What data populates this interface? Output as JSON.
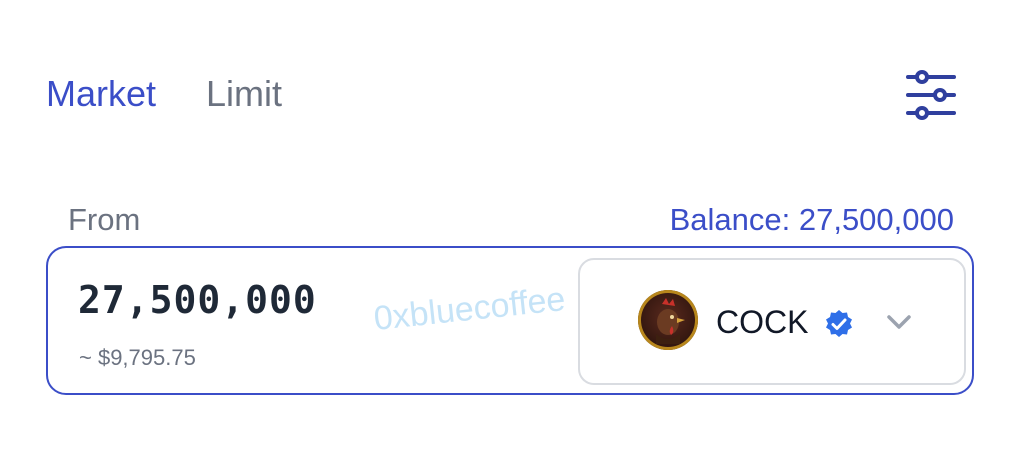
{
  "tabs": [
    {
      "label": "Market",
      "active": true
    },
    {
      "label": "Limit",
      "active": false
    }
  ],
  "settings_icon": "sliders-icon",
  "from": {
    "label": "From",
    "balance_label": "Balance: 27,500,000",
    "amount": "27,500,000",
    "usd_value": "~ $9,795.75"
  },
  "token": {
    "symbol": "COCK",
    "verified": true,
    "logo_icon": "rooster-logo-icon"
  },
  "watermark": "0xbluecoffee",
  "colors": {
    "accent": "#3b4ec8",
    "muted": "#6b7280",
    "verified": "#2f6fe8"
  }
}
